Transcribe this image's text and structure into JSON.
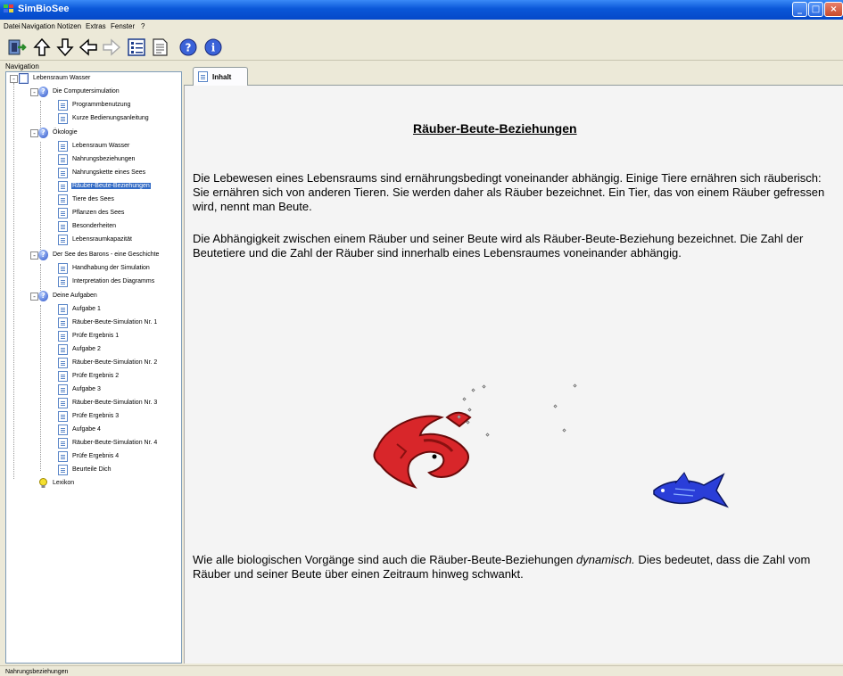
{
  "window": {
    "title": "SimBioSee"
  },
  "menu": [
    "Datei",
    "Navigation",
    "Notizen",
    "Extras",
    "Fenster",
    "?"
  ],
  "toolbar": {
    "buttons": [
      "app-icon",
      "arrow-up-icon",
      "arrow-down-icon",
      "arrow-left-icon",
      "arrow-right-icon",
      "tree-view-icon",
      "page-view-icon",
      "help-icon",
      "info-icon"
    ]
  },
  "navigation": {
    "label": "Navigation",
    "root": "Lebensraum Wasser",
    "groups": [
      {
        "label": "Die Computersimulation",
        "items": [
          "Programmbenutzung",
          "Kurze Bedienungsanleitung"
        ]
      },
      {
        "label": "Ökologie",
        "items": [
          "Lebensraum Wasser",
          "Nahrungsbeziehungen",
          "Nahrungskette eines Sees",
          "Räuber-Beute-Beziehungen",
          "Tiere des Sees",
          "Pflanzen des Sees",
          "Besonderheiten",
          "Lebensraumkapazität"
        ]
      },
      {
        "label": "Der See des Barons - eine Geschichte",
        "items": [
          "Handhabung der Simulation",
          "Interpretation des Diagramms"
        ]
      },
      {
        "label": "Deine Aufgaben",
        "items": [
          "Aufgabe 1",
          "Räuber-Beute-Simulation Nr. 1",
          "Prüfe Ergebnis 1",
          "Aufgabe 2",
          "Räuber-Beute-Simulation Nr. 2",
          "Prüfe Ergebnis 2",
          "Aufgabe 3",
          "Räuber-Beute-Simulation Nr. 3",
          "Prüfe Ergebnis 3",
          "Aufgabe 4",
          "Räuber-Beute-Simulation Nr. 4",
          "Prüfe Ergebnis 4",
          "Beurteile Dich"
        ]
      }
    ],
    "extra": "Lexikon",
    "selected": "Räuber-Beute-Beziehungen"
  },
  "tab": {
    "label": "Inhalt"
  },
  "content": {
    "heading": "Räuber-Beute-Beziehungen",
    "para1": "Die Lebewesen eines Lebensraums sind ernährungsbedingt voneinander abhängig. Einige Tiere ernähren sich räuberisch: Sie ernähren sich von anderen Tieren. Sie werden daher als Räuber bezeichnet. Ein Tier, das von einem Räuber gefressen wird, nennt man Beute.",
    "para2": "Die Abhängigkeit zwischen einem Räuber und seiner Beute wird als Räuber-Beute-Beziehung bezeichnet. Die Zahl der Beutetiere und die Zahl der Räuber sind innerhalb eines Lebensraumes voneinander abhängig.",
    "para3_pre": "Wie alle biologischen Vorgänge sind auch die Räuber-Beute-Beziehungen ",
    "para3_em": "dynamisch.",
    "para3_post": " Dies bedeutet, dass die Zahl vom Räuber und seiner Beute über einen Zeitraum hinweg schwankt."
  },
  "status": {
    "text": "Nahrungsbeziehungen"
  },
  "colors": {
    "selection": "#316ac5",
    "titlebar": "#0a57d8",
    "predator": "#d8262a",
    "prey": "#2a3ed8"
  }
}
